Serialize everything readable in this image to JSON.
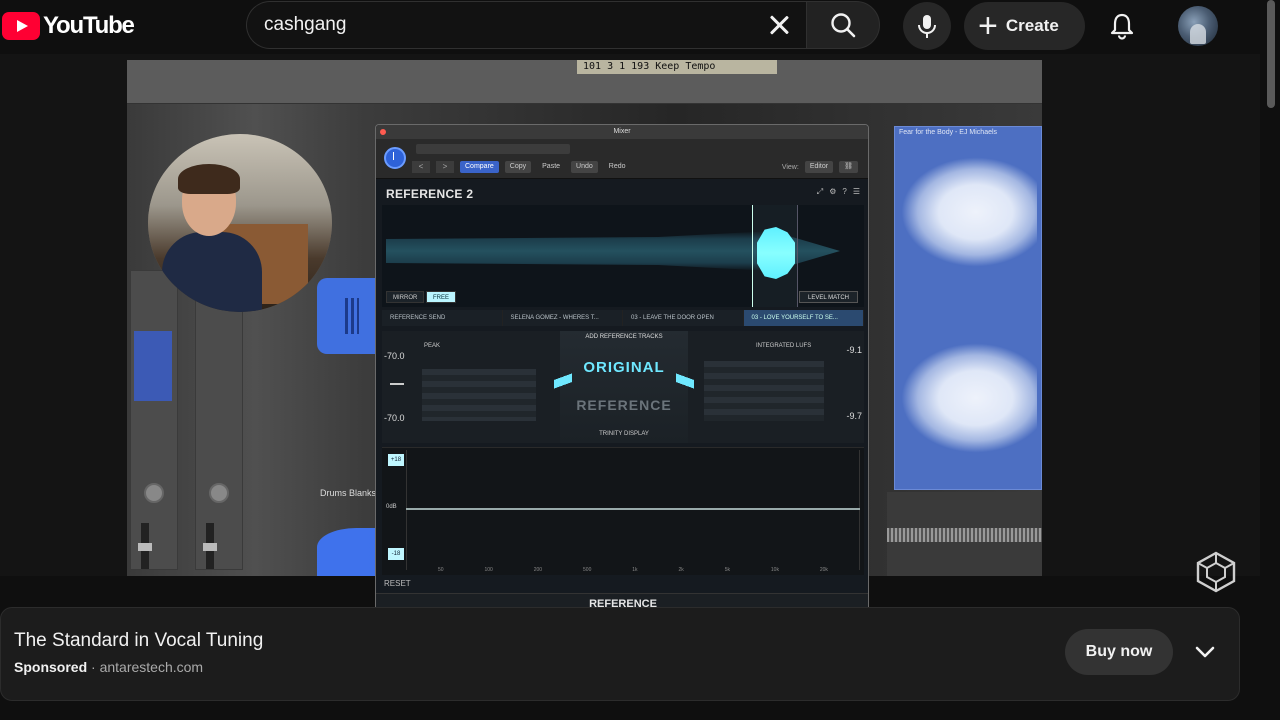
{
  "header": {
    "logo_text": "YouTube",
    "search_query": "cashgang",
    "create_label": "Create"
  },
  "video": {
    "daw": {
      "lcd_text": "101  3  1  193   Keep Tempo",
      "drums_label": "Drums Blanks",
      "region_title": "Fear for the Body - EJ Michaels"
    },
    "plugin": {
      "window_title": "Mixer",
      "buttons": {
        "compare": "Compare",
        "copy": "Copy",
        "paste": "Paste",
        "undo": "Undo",
        "redo": "Redo",
        "view": "View:",
        "editor": "Editor"
      },
      "name": "REFERENCE 2",
      "mirror": "MIRROR",
      "free": "FREE",
      "level_match": "LEVEL MATCH",
      "tracks": [
        "REFERENCE SEND",
        "SELENA GOMEZ - WHERES T...",
        "03 - LEAVE THE DOOR OPEN",
        "03 - LOVE YOURSELF TO SE..."
      ],
      "add_reference": "ADD REFERENCE TRACKS",
      "original": "ORIGINAL",
      "reference": "REFERENCE",
      "trinity": "TRINITY DISPLAY",
      "peak_label": "PEAK",
      "lufs_label": "INTEGRATED LUFS",
      "left_top": "-70.0",
      "left_bottom": "-70.0",
      "right_top": "-9.1",
      "right_bottom": "-9.7",
      "eq_plus": "+18",
      "eq_zero": "0dB",
      "eq_minus": "-18",
      "freqs": [
        "50",
        "100",
        "200",
        "500",
        "1k",
        "2k",
        "5k",
        "10k",
        "20k"
      ],
      "reset": "RESET",
      "footer": "REFERENCE"
    }
  },
  "ad": {
    "title": "The Standard in Vocal Tuning",
    "sponsored": "Sponsored",
    "domain": "· antarestech.com",
    "button": "Buy now"
  },
  "colors": {
    "youtube_red": "#ff0033",
    "accent_cyan": "#6fe8ff",
    "region_blue": "#4d6fc2"
  }
}
